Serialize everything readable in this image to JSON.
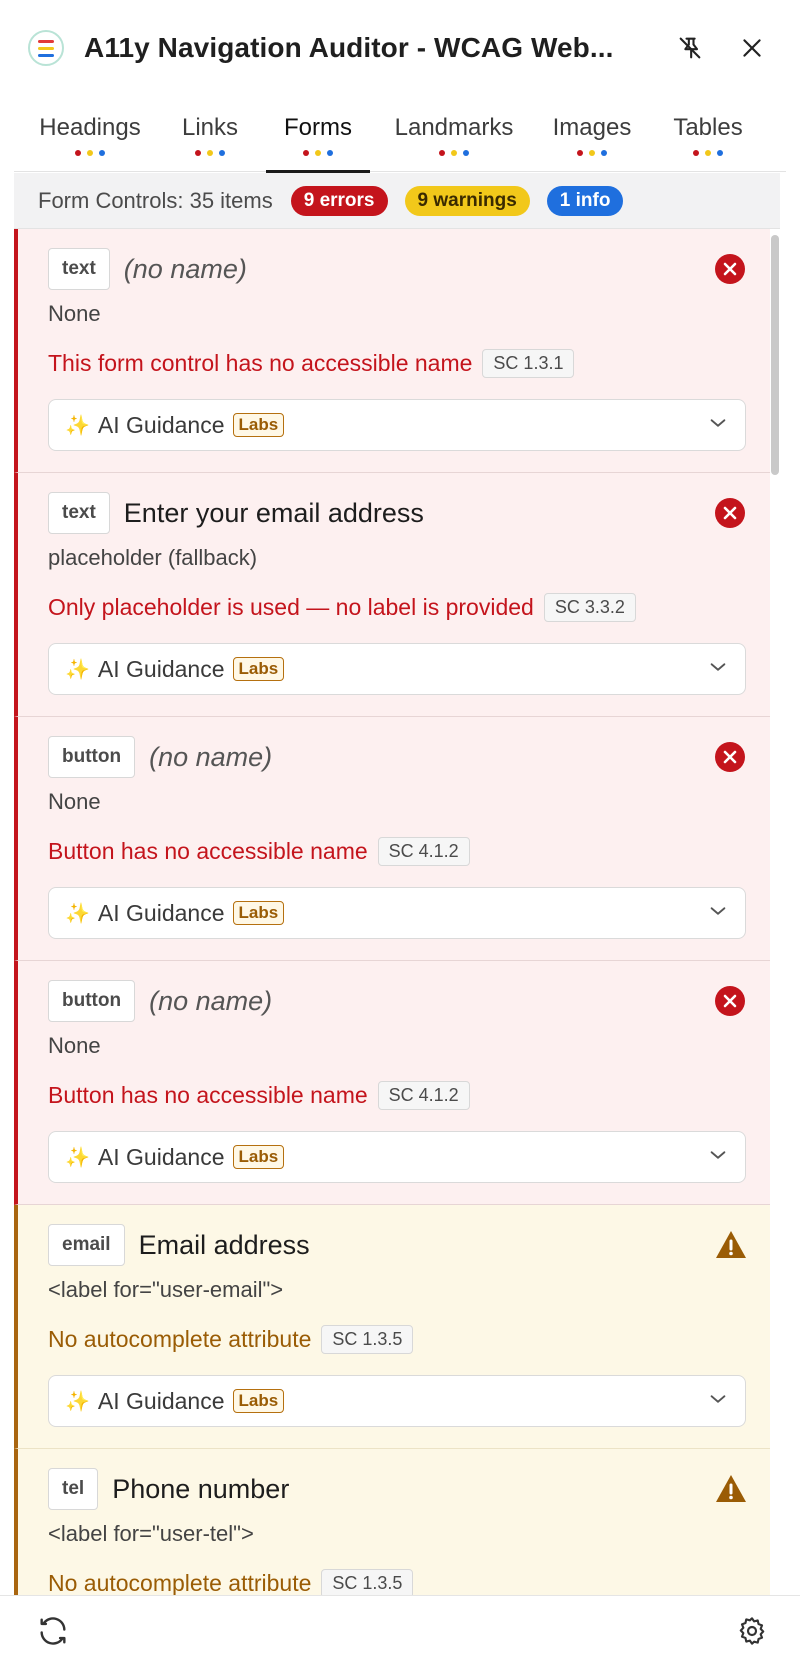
{
  "window": {
    "title": "A11y Navigation Auditor - WCAG Web..."
  },
  "tabs": [
    {
      "label": "Headings",
      "active": false
    },
    {
      "label": "Links",
      "active": false
    },
    {
      "label": "Forms",
      "active": true
    },
    {
      "label": "Landmarks",
      "active": false
    },
    {
      "label": "Images",
      "active": false
    },
    {
      "label": "Tables",
      "active": false
    }
  ],
  "summary": {
    "label": "Form Controls: 35 items",
    "errors": "9 errors",
    "warnings": "9 warnings",
    "info": "1 info"
  },
  "ai_guidance": {
    "label": "AI Guidance",
    "badge": "Labs"
  },
  "colors": {
    "error": "#c4141c",
    "warning": "#f2c81a",
    "info": "#1f6fde",
    "warning_text": "#9a5c05"
  },
  "items": [
    {
      "severity": "error",
      "type": "text",
      "name": "(no name)",
      "name_empty": true,
      "source": "None",
      "issue": "This form control has no accessible name",
      "sc": "SC 1.3.1"
    },
    {
      "severity": "error",
      "type": "text",
      "name": "Enter your email address",
      "name_empty": false,
      "source": "placeholder (fallback)",
      "issue": "Only placeholder is used — no label is provided",
      "sc": "SC 3.3.2"
    },
    {
      "severity": "error",
      "type": "button",
      "name": "(no name)",
      "name_empty": true,
      "source": "None",
      "issue": "Button has no accessible name",
      "sc": "SC 4.1.2"
    },
    {
      "severity": "error",
      "type": "button",
      "name": "(no name)",
      "name_empty": true,
      "source": "None",
      "issue": "Button has no accessible name",
      "sc": "SC 4.1.2"
    },
    {
      "severity": "warning",
      "type": "email",
      "name": "Email address",
      "name_empty": false,
      "source": "<label for=\"user-email\">",
      "issue": "No autocomplete attribute",
      "sc": "SC 1.3.5"
    },
    {
      "severity": "warning",
      "type": "tel",
      "name": "Phone number",
      "name_empty": false,
      "source": "<label for=\"user-tel\">",
      "issue": "No autocomplete attribute",
      "sc": "SC 1.3.5"
    }
  ]
}
